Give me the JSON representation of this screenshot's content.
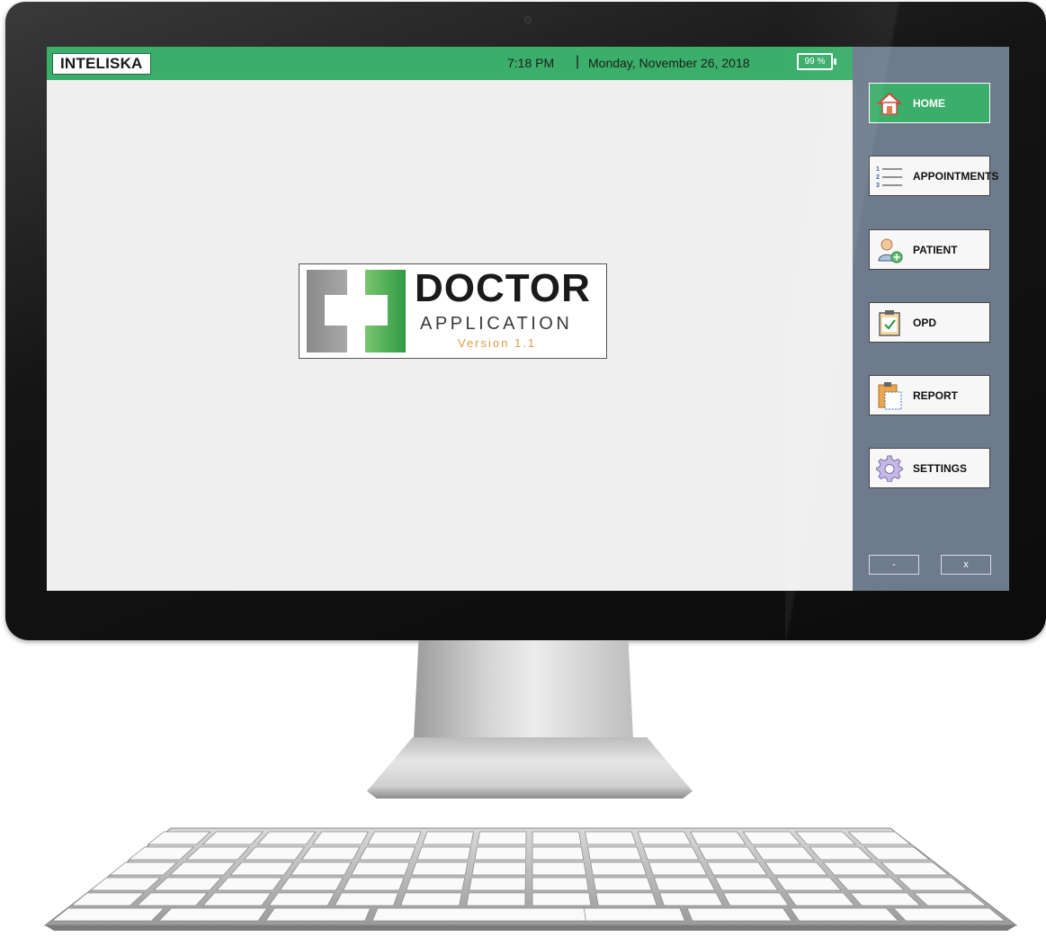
{
  "topbar": {
    "logo": "INTELISKA",
    "time": "7:18 PM",
    "separator": "|",
    "date": "Monday, November 26, 2018",
    "battery": "99 %"
  },
  "splash": {
    "title": "DOCTOR",
    "subtitle": "APPLICATION",
    "version": "Version 1.1"
  },
  "sidebar": {
    "items": [
      {
        "label": "HOME",
        "icon": "house-icon",
        "active": true
      },
      {
        "label": "APPOINTMENTS",
        "icon": "numbered-list-icon",
        "active": false
      },
      {
        "label": "PATIENT",
        "icon": "add-user-icon",
        "active": false
      },
      {
        "label": "OPD",
        "icon": "checklist-clipboard-icon",
        "active": false
      },
      {
        "label": "REPORT",
        "icon": "clipboard-icon",
        "active": false
      },
      {
        "label": "SETTINGS",
        "icon": "gear-icon",
        "active": false
      }
    ],
    "minimize_label": "-",
    "close_label": "x"
  },
  "colors": {
    "accent_green": "#3aae6a",
    "sidebar_bg": "#6d7b8c",
    "content_bg": "#efefef",
    "version_orange": "#e39a45"
  }
}
